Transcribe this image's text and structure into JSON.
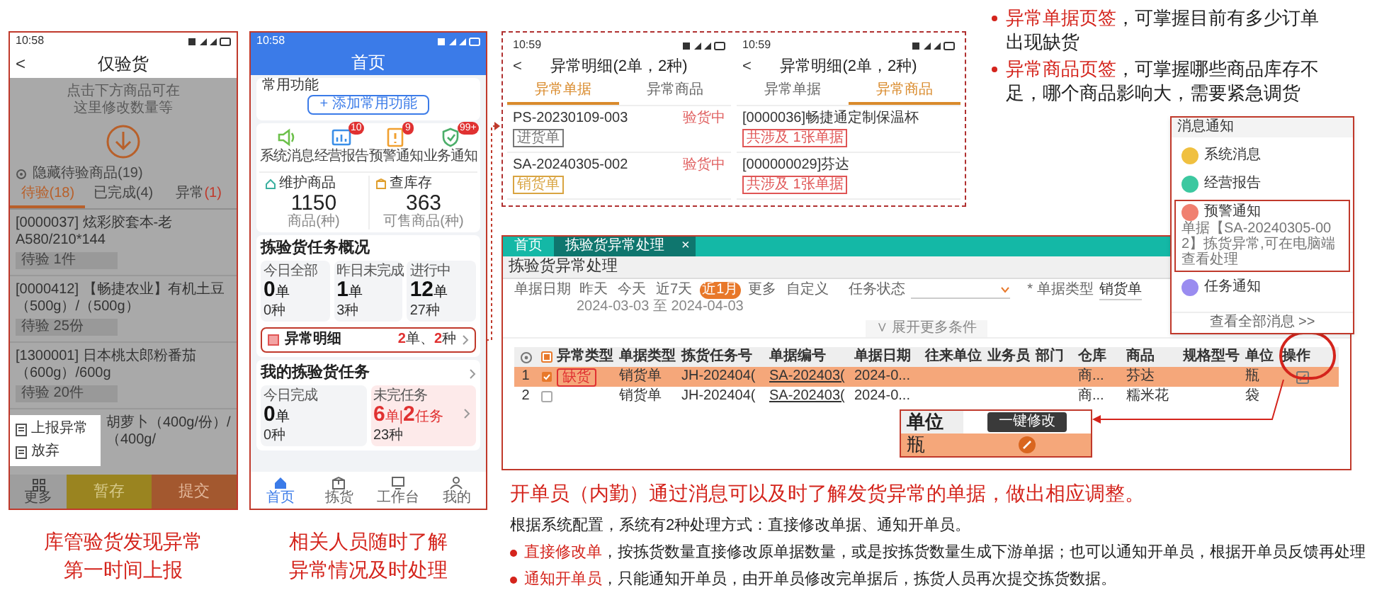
{
  "phone_check": {
    "status_time": "10:58",
    "back": "<",
    "title": "仅验货",
    "hint": "点击下方商品可在这里修改数量等",
    "hidden_toggle": "隐藏待验商品(19)",
    "tabs": [
      {
        "label": "待验(18)",
        "selected": true
      },
      {
        "label": "已完成(4)",
        "selected": false
      },
      {
        "label": "异常",
        "count": "(1)",
        "selected": false
      }
    ],
    "items": [
      {
        "name": "[0000037] 炫彩胶套本-老A580/210*144",
        "tag": "待验 1件"
      },
      {
        "name": "[0000412] 【畅捷农业】有机土豆（500g）/（500g）",
        "tag": "待验 25份"
      },
      {
        "name": "[1300001] 日本桃太郎粉番茄（600g）/600g",
        "tag": "待验 20件"
      }
    ],
    "partial_item": "胡萝卜（400g/份）/（400g/",
    "menu": [
      {
        "label": "上报异常"
      },
      {
        "label": "放弃"
      }
    ],
    "bottom": {
      "more": "更多",
      "save": "暂存",
      "submit": "提交"
    },
    "caption": "库管验货发现异常第一时间上报"
  },
  "phone_home": {
    "status_time": "10:58",
    "title": "首页",
    "common_title": "常用功能",
    "add_button": "+ 添加常用功能",
    "shortcuts": [
      {
        "label": "系统消息"
      },
      {
        "label": "经营报告",
        "badge": "10"
      },
      {
        "label": "预警通知",
        "badge": "9"
      },
      {
        "label": "业务通知",
        "badge": "99+"
      }
    ],
    "stock": [
      {
        "label": "维护商品",
        "value": "1150",
        "unit": "商品(种)"
      },
      {
        "label": "查库存",
        "value": "363",
        "unit": "可售商品(种)"
      }
    ],
    "overview": {
      "title": "拣验货任务概况",
      "cells": [
        {
          "label": "今日全部",
          "count": "0",
          "count_unit": "单",
          "sub": "0种"
        },
        {
          "label": "昨日未完成",
          "count": "1",
          "count_unit": "单",
          "sub": "3种"
        },
        {
          "label": "进行中",
          "count": "12",
          "count_unit": "单",
          "sub": "27种"
        }
      ]
    },
    "abnormal": {
      "label": "异常明细",
      "orders": "2",
      "orders_unit": "单、",
      "kinds": "2",
      "kinds_unit": "种"
    },
    "mine": {
      "title": "我的拣验货任务",
      "cells": [
        {
          "label": "今日完成",
          "count": "0",
          "count_unit": "单",
          "sub": "0种"
        },
        {
          "label": "未完任务",
          "count": "6",
          "count_unit": "单|",
          "count2": "2",
          "count2_unit": "任务",
          "sub": "23种"
        }
      ]
    },
    "nav": [
      {
        "label": "首页",
        "selected": true
      },
      {
        "label": "拣货",
        "selected": false
      },
      {
        "label": "工作台",
        "selected": false
      },
      {
        "label": "我的",
        "selected": false
      }
    ],
    "caption": "相关人员随时了解异常情况及时处理"
  },
  "detail_screens": [
    {
      "status_time": "10:59",
      "back": "<",
      "title": "异常明细(2单，2种)",
      "tabs": [
        {
          "label": "异常单据",
          "selected": true
        },
        {
          "label": "异常商品",
          "selected": false
        }
      ],
      "rows": [
        {
          "title": "PS-20230109-003",
          "tag": "进货单",
          "color": "#777777",
          "status": "验货中"
        },
        {
          "title": "SA-20240305-002",
          "tag": "销货单",
          "color": "#d9a441",
          "status": "验货中"
        }
      ]
    },
    {
      "status_time": "10:59",
      "back": "<",
      "title": "异常明细(2单，2种)",
      "tabs": [
        {
          "label": "异常单据",
          "selected": false
        },
        {
          "label": "异常商品",
          "selected": true
        }
      ],
      "rows": [
        {
          "title": "[0000036]畅捷通定制保温杯",
          "tag": "共涉及 1张单据",
          "color": "#e05555"
        },
        {
          "title": "[000000029]芬达",
          "tag": "共涉及 1张单据",
          "color": "#e05555"
        }
      ]
    }
  ],
  "top_notes": [
    {
      "lead": "异常单据页签",
      "text": "，可掌握目前有多少订单出现缺货"
    },
    {
      "lead": "异常商品页签",
      "text": "，可掌握哪些商品库存不足，哪个商品影响大，需要紧急调货"
    }
  ],
  "notifications": {
    "title": "消息通知",
    "items": [
      {
        "label": "系统消息",
        "color": "#f0c040",
        "selected": false
      },
      {
        "label": "经营报告",
        "color": "#3cc8a0",
        "selected": false
      },
      {
        "label": "预警通知",
        "detail": "单据【SA-20240305-002】拣货异常,可在电脑端查看处理",
        "color": "#f08070",
        "selected": true
      },
      {
        "label": "任务通知",
        "color": "#9a8cf0",
        "selected": false
      }
    ],
    "footer": "查看全部消息 >>"
  },
  "web_app": {
    "tabs": [
      {
        "label": "首页",
        "selected": false
      },
      {
        "label": "拣验货异常处理",
        "selected": true
      }
    ],
    "close": "×",
    "title": "拣验货异常处理",
    "filters": {
      "date_label": "单据日期",
      "date_options": [
        {
          "label": "昨天",
          "selected": false
        },
        {
          "label": "今天",
          "selected": false
        },
        {
          "label": "近7天",
          "selected": false
        },
        {
          "label": "近1月",
          "selected": true
        },
        {
          "label": "更多",
          "selected": false
        },
        {
          "label": "自定义",
          "selected": false
        }
      ],
      "date_range": "2024-03-03 至 2024-04-03",
      "status_label": "任务状态",
      "type_label": "* 单据类型",
      "type_value": "销货单",
      "expand": "∨ 展开更多条件"
    },
    "table": {
      "columns": [
        "异常类型",
        "单据类型",
        "拣货任务号",
        "单据编号",
        "单据日期",
        "往来单位",
        "业务员",
        "部门",
        "仓库",
        "商品",
        "规格型号",
        "单位",
        "操作"
      ],
      "rows": [
        {
          "index": "1",
          "checked": true,
          "selected": true,
          "type": "缺货",
          "doc_type": "销货单",
          "task_no": "JH-202404(",
          "doc_no": "SA-202403(",
          "date": "2024-0...",
          "warehouse": "商...",
          "product": "芬达",
          "unit": "瓶",
          "editable": true
        },
        {
          "index": "2",
          "checked": false,
          "selected": false,
          "doc_type": "销货单",
          "task_no": "JH-202404(",
          "doc_no": "SA-202403(",
          "date": "2024-0...",
          "warehouse": "商...",
          "product": "糯米花",
          "unit": "袋",
          "editable": false
        }
      ]
    },
    "zoom_popup": {
      "header": "单位",
      "rows": [
        {
          "value": "瓶",
          "selected": true
        }
      ],
      "tooltip": "一键修改"
    }
  },
  "bottom_text": {
    "heading": "开单员（内勤）通过消息可以及时了解发货异常的单据，做出相应调整。",
    "intro": "根据系统配置，系统有2种处理方式：直接修改单据、通知开单员。",
    "bullets": [
      {
        "lead": "直接修改单",
        "text": "，按拣货数量直接修改原单据数量，或是按拣货数量生成下游单据；也可以通知开单员，根据开单员反馈再处理"
      },
      {
        "lead": "通知开单员",
        "text": "，只能通知开单员，由开单员修改完单据后，拣货人员再次提交拣货数据。"
      }
    ]
  }
}
